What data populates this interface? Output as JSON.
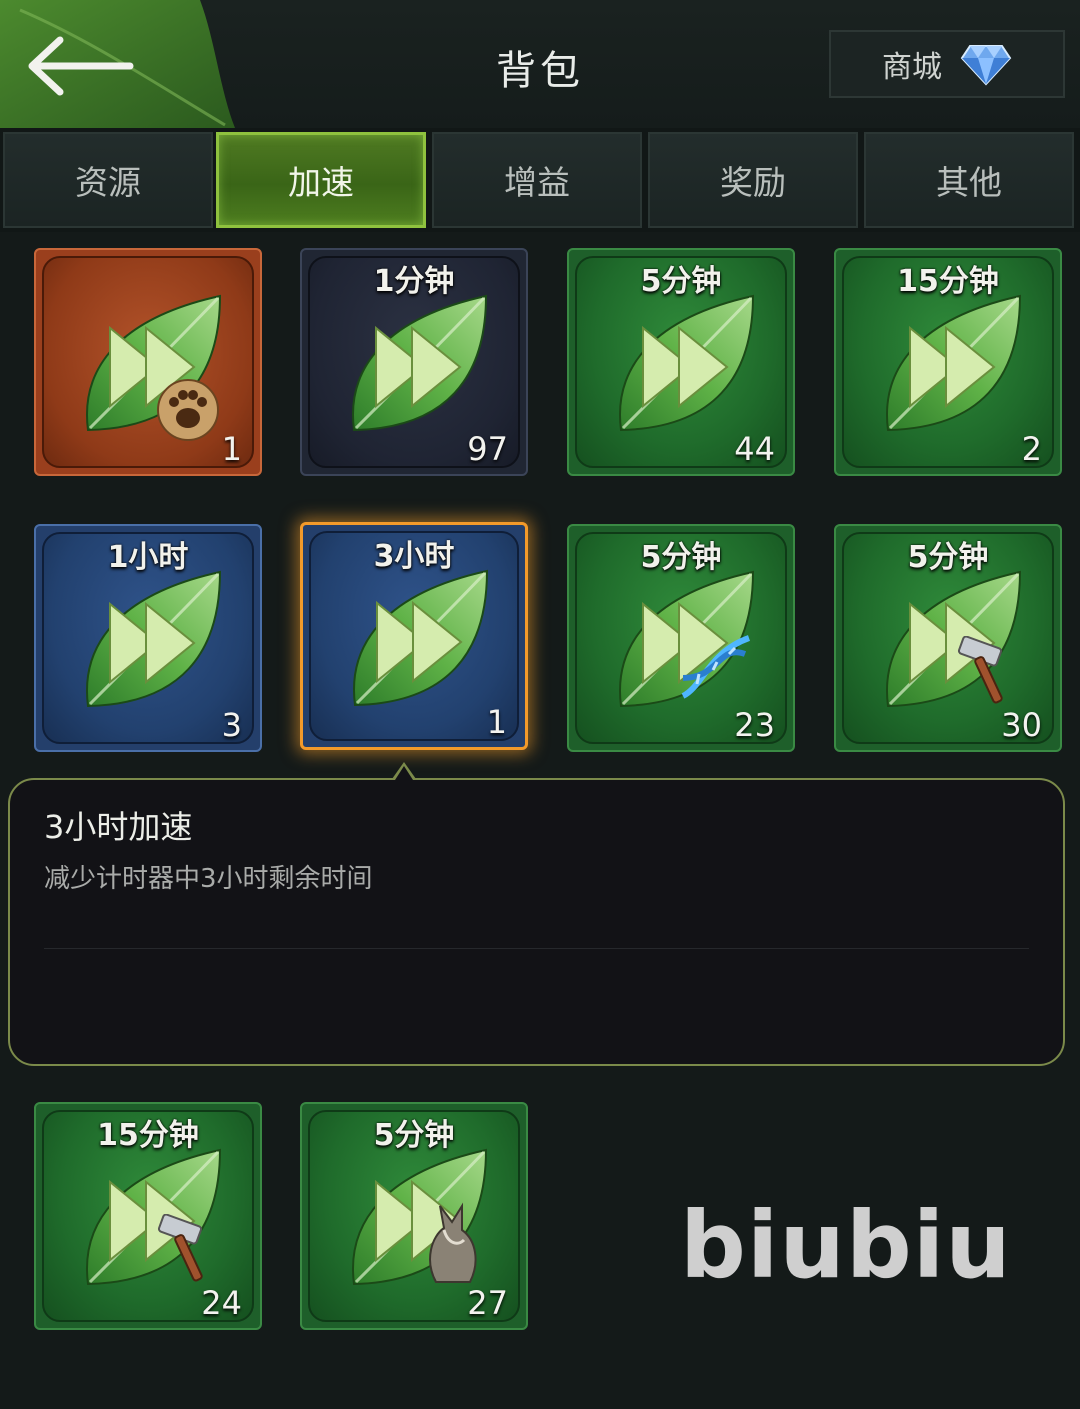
{
  "header": {
    "title": "背包",
    "back_icon": "arrow-left-icon",
    "shop_label": "商城",
    "shop_icon": "diamond-icon"
  },
  "tabs": [
    {
      "label": "资源",
      "active": false
    },
    {
      "label": "加速",
      "active": true
    },
    {
      "label": "增益",
      "active": false
    },
    {
      "label": "奖励",
      "active": false
    },
    {
      "label": "其他",
      "active": false
    }
  ],
  "items": [
    {
      "duration": "",
      "count": "1",
      "frame": "orange",
      "badge": "paw-icon",
      "selected": false
    },
    {
      "duration": "1分钟",
      "count": "97",
      "frame": "dark",
      "badge": "",
      "selected": false
    },
    {
      "duration": "5分钟",
      "count": "44",
      "frame": "green",
      "badge": "",
      "selected": false
    },
    {
      "duration": "15分钟",
      "count": "2",
      "frame": "green",
      "badge": "",
      "selected": false
    },
    {
      "duration": "1小时",
      "count": "3",
      "frame": "blue",
      "badge": "",
      "selected": false
    },
    {
      "duration": "3小时",
      "count": "1",
      "frame": "blue",
      "badge": "",
      "selected": true
    },
    {
      "duration": "5分钟",
      "count": "23",
      "frame": "green",
      "badge": "dna-icon",
      "selected": false
    },
    {
      "duration": "5分钟",
      "count": "30",
      "frame": "green",
      "badge": "hammer-icon",
      "selected": false
    },
    {
      "duration": "15分钟",
      "count": "24",
      "frame": "green",
      "badge": "hammer-icon",
      "selected": false
    },
    {
      "duration": "5分钟",
      "count": "27",
      "frame": "green",
      "badge": "wolf-icon",
      "selected": false
    }
  ],
  "detail": {
    "title": "3小时加速",
    "description": "减少计时器中3小时剩余时间"
  },
  "watermark": "biubiu",
  "colors": {
    "background": "#141a19",
    "tab_active": "#4f7a22",
    "selection_glow": "#f39a2a",
    "panel_border": "#7b8a4a"
  }
}
